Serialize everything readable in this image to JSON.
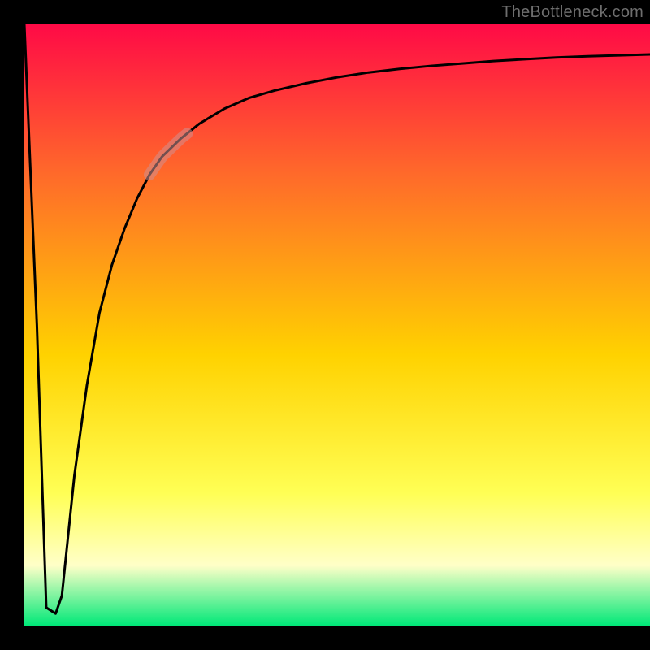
{
  "watermark": "TheBottleneck.com",
  "colors": {
    "frame": "#000000",
    "curve": "#000000",
    "accent": "#cf8f8f",
    "gradient_top": "#ff0a46",
    "gradient_mid_upper": "#ff6a2a",
    "gradient_mid": "#ffd200",
    "gradient_mid_lower": "#ffff55",
    "gradient_pale": "#ffffc8",
    "gradient_bottom": "#00e878"
  },
  "chart_data": {
    "type": "line",
    "title": "",
    "xlabel": "",
    "ylabel": "",
    "xlim": [
      0,
      100
    ],
    "ylim": [
      0,
      100
    ],
    "grid": false,
    "legend": false,
    "series": [
      {
        "name": "curve",
        "x": [
          0,
          2,
          3.5,
          5,
          6,
          7,
          8,
          10,
          12,
          14,
          16,
          18,
          20,
          22,
          25,
          28,
          32,
          36,
          40,
          45,
          50,
          55,
          60,
          65,
          70,
          75,
          80,
          85,
          90,
          95,
          100
        ],
        "y": [
          100,
          50,
          3,
          2,
          5,
          15,
          25,
          40,
          52,
          60,
          66,
          71,
          75,
          78,
          81,
          83.5,
          86,
          87.8,
          89,
          90.2,
          91.2,
          92,
          92.6,
          93.1,
          93.5,
          93.9,
          94.2,
          94.5,
          94.7,
          94.85,
          95
        ]
      }
    ],
    "accent_segment": {
      "series": "curve",
      "x_start": 20,
      "x_end": 26,
      "note": "pale overlay stroke on curve"
    },
    "background": {
      "type": "vertical-gradient",
      "stops": [
        {
          "pos": 0.0,
          "color": "#ff0a46"
        },
        {
          "pos": 0.25,
          "color": "#ff6a2a"
        },
        {
          "pos": 0.55,
          "color": "#ffd200"
        },
        {
          "pos": 0.78,
          "color": "#ffff55"
        },
        {
          "pos": 0.9,
          "color": "#ffffc8"
        },
        {
          "pos": 1.0,
          "color": "#00e878"
        }
      ]
    }
  }
}
